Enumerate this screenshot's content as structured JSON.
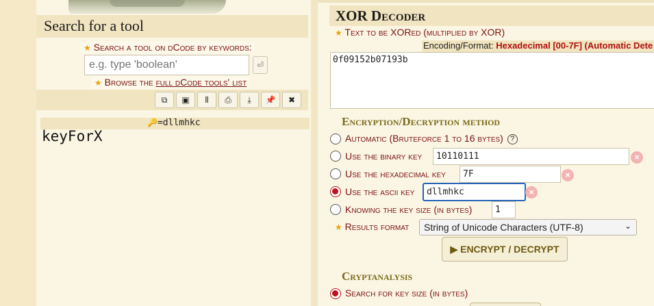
{
  "left": {
    "search_title": "Search for a tool",
    "search_label": "Search a tool on dCode by keywords:",
    "search_placeholder": "e.g. type 'boolean'",
    "enter_glyph": "⏎",
    "browse_prefix": "Browse the ",
    "browse_link": "full dCode tools' list",
    "toolbar_icons": [
      "copy-icon",
      "screenshot-icon",
      "columns-icon",
      "print-icon",
      "download-icon",
      "pin-icon",
      "close-icon"
    ],
    "toolbar_glyphs": [
      "⧉",
      "▣",
      "⦀",
      "⎙",
      "⤓",
      "📌",
      "✖"
    ],
    "key_display": "=dllmhkc",
    "result": "keyForX"
  },
  "right": {
    "title": "XOR Decoder",
    "text_label": "Text to be XORed (multiplied by XOR)",
    "encoding_prefix": "Encoding/Format: ",
    "encoding_value": "Hexadecimal [00-7F] (Automatic Dete",
    "input_text": "0f09152b07193b",
    "method_title": "Encryption/Decryption method",
    "options": {
      "automatic": "Automatic (Bruteforce 1 to 16 bytes)",
      "binary": "Use the binary key",
      "hex": "Use the hexadecimal key",
      "ascii": "Use the ascii key",
      "keysize": "Knowing the key size (in bytes)"
    },
    "binary_key": "10110111",
    "hex_key": "7F",
    "ascii_key": "dllmhkc",
    "key_size": "1",
    "results_label": "Results format",
    "results_format": "String of Unicode Characters (UTF-8)",
    "run_button": "▶ ENCRYPT / DECRYPT",
    "crypto_title": "Cryptanalysis",
    "search_key_size": "Search for key size (in bytes)"
  }
}
